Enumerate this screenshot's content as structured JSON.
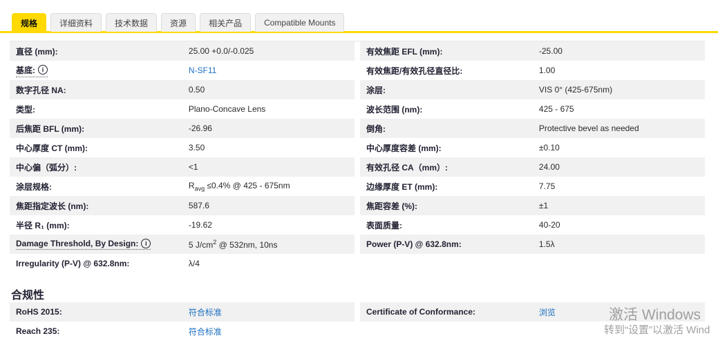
{
  "tabs": {
    "items": [
      {
        "label": "规格",
        "active": true
      },
      {
        "label": "详细资料",
        "active": false
      },
      {
        "label": "技术数据",
        "active": false
      },
      {
        "label": "资源",
        "active": false
      },
      {
        "label": "相关产品",
        "active": false
      },
      {
        "label": "Compatible Mounts",
        "active": false
      }
    ]
  },
  "colors": {
    "accent_yellow": "#ffd900",
    "row_stripe": "#f1f1f1",
    "link_blue": "#1b6fc0"
  },
  "spec_table": {
    "left_rows": [
      {
        "label": "直径 (mm):",
        "value": "25.00 +0.0/-0.025"
      },
      {
        "label": "基底:",
        "value": "N-SF11",
        "link": true,
        "info": true
      },
      {
        "label": "数字孔径 NA:",
        "value": "0.50"
      },
      {
        "label": "类型:",
        "value": "Plano-Concave Lens"
      },
      {
        "label": "后焦距 BFL (mm):",
        "value": "-26.96"
      },
      {
        "label": "中心厚度 CT (mm):",
        "value": "3.50"
      },
      {
        "label": "中心偏（弧分）:",
        "value": "<1"
      },
      {
        "label": "涂层规格:",
        "value_html": "R<sub>avg</sub> ≤0.4% @ 425 - 675nm"
      },
      {
        "label": "焦距指定波长 (nm):",
        "value": "587.6"
      },
      {
        "label": "半径 R₁ (mm):",
        "value": "-19.62"
      },
      {
        "label": "Damage Threshold, By Design:",
        "value_html": "5 J/cm<sup>2</sup> @ 532nm, 10ns",
        "info": true
      },
      {
        "label": "Irregularity (P-V) @ 632.8nm:",
        "value": "λ/4"
      }
    ],
    "right_rows": [
      {
        "label": "有效焦距 EFL (mm):",
        "value": "-25.00"
      },
      {
        "label": "有效焦距/有效孔径直径比:",
        "value": "1.00"
      },
      {
        "label": "涂层:",
        "value": "VIS 0° (425-675nm)"
      },
      {
        "label": "波长范围 (nm):",
        "value": "425 - 675"
      },
      {
        "label": "倒角:",
        "value": "Protective bevel as needed"
      },
      {
        "label": "中心厚度容差 (mm):",
        "value": "±0.10"
      },
      {
        "label": "有效孔径 CA（mm）:",
        "value": "24.00"
      },
      {
        "label": "边缘厚度 ET (mm):",
        "value": "7.75"
      },
      {
        "label": "焦距容差 (%):",
        "value": "±1"
      },
      {
        "label": "表面质量:",
        "value": "40-20"
      },
      {
        "label": "Power (P-V) @ 632.8nm:",
        "value": "1.5λ"
      }
    ]
  },
  "compliance": {
    "title": "合规性",
    "left_rows": [
      {
        "label": "RoHS 2015:",
        "value": "符合标准",
        "link": true
      },
      {
        "label": "Reach 235:",
        "value": "符合标准",
        "link": true
      }
    ],
    "right_rows": [
      {
        "label": "Certificate of Conformance:",
        "value": "浏览",
        "link": true
      }
    ]
  },
  "watermark": {
    "line1": "激活 Windows",
    "line2": "转到“设置”以激活 Wind"
  }
}
